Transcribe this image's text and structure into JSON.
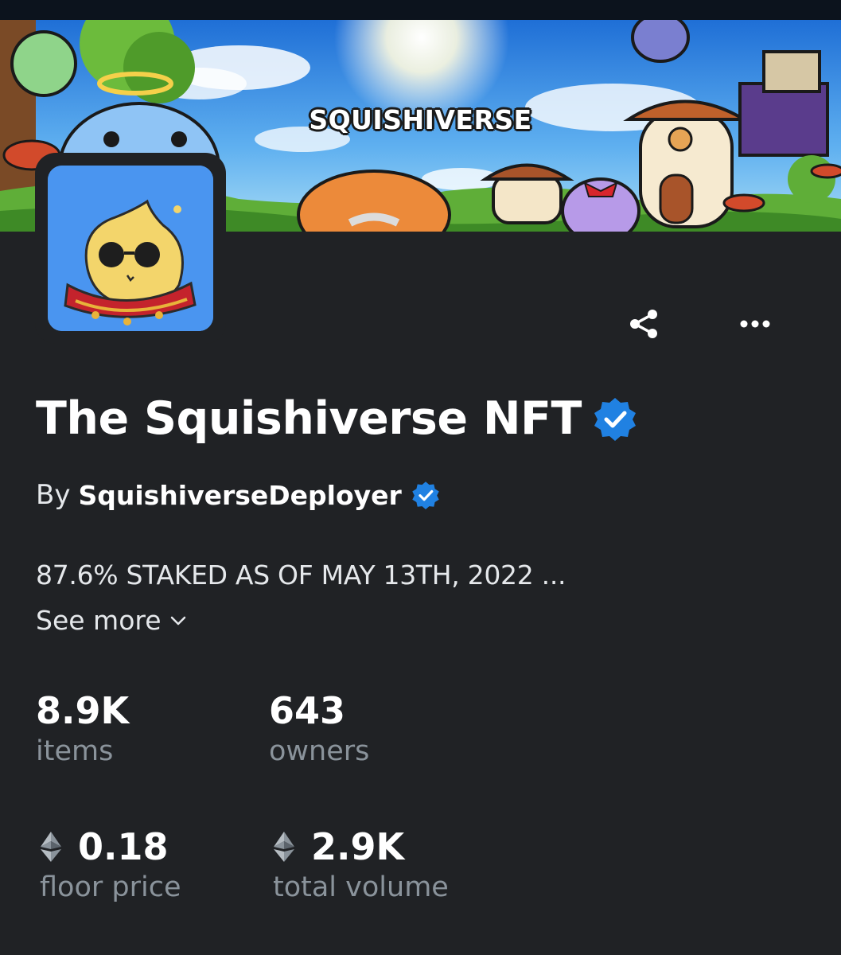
{
  "colors": {
    "background": "#202225",
    "verified_badge": "#2081e2",
    "muted_text": "#8a939b",
    "avatar_background": "#4a95f0"
  },
  "banner": {
    "logo_text": "SQUISHIVERSE"
  },
  "icons": {
    "share": "share-icon",
    "more": "more-horizontal-icon",
    "verified": "verified-badge-icon",
    "chevron": "chevron-down-icon",
    "eth": "ethereum-icon"
  },
  "collection": {
    "title": "The Squishiverse NFT",
    "by_label": "By",
    "creator": "SquishiverseDeployer",
    "description": "87.6% STAKED AS OF MAY 13TH, 2022 ...",
    "see_more_label": "See more"
  },
  "stats": {
    "items": {
      "value": "8.9K",
      "label": "items"
    },
    "owners": {
      "value": "643",
      "label": "owners"
    },
    "floor_price": {
      "value": "0.18",
      "label": "floor price"
    },
    "total_volume": {
      "value": "2.9K",
      "label": "total volume"
    }
  }
}
